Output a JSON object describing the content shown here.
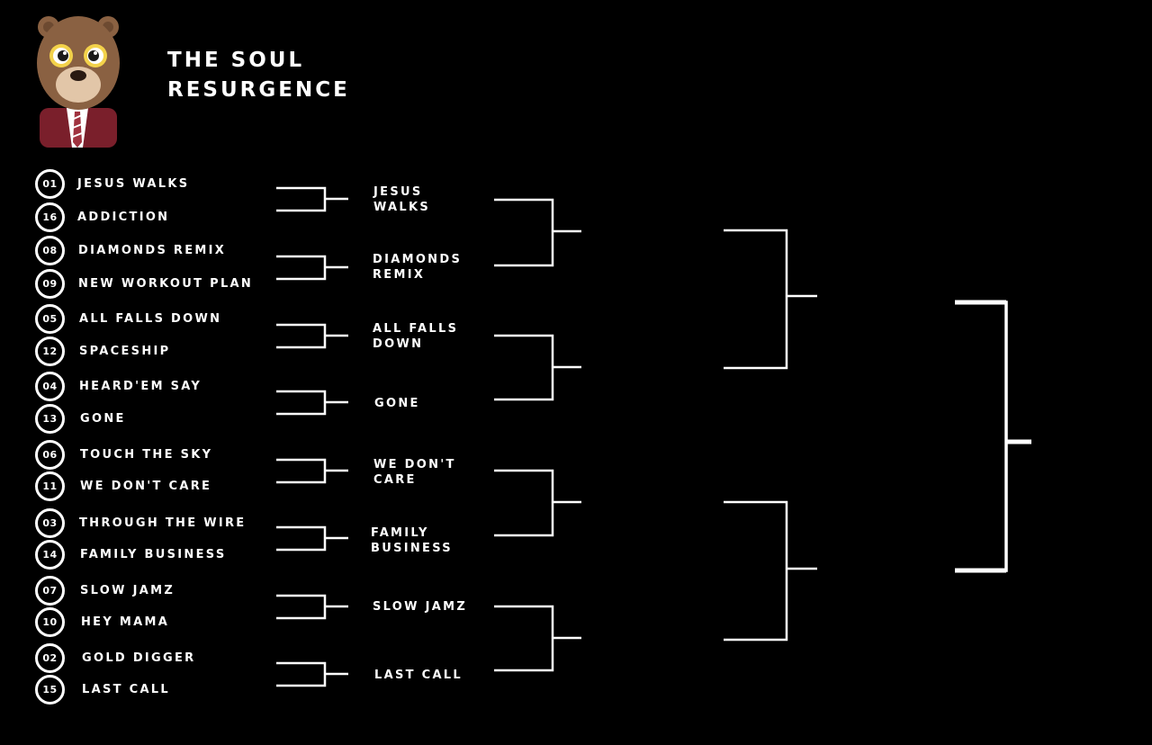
{
  "header": {
    "title_line1": "THE SOUL",
    "title_line2": "RESURGENCE",
    "logo_icon": "dropout-bear-icon"
  },
  "round1": [
    {
      "seed": "01",
      "song": "JESUS WALKS"
    },
    {
      "seed": "16",
      "song": "ADDICTION"
    },
    {
      "seed": "08",
      "song": "DIAMONDS REMIX"
    },
    {
      "seed": "09",
      "song": "NEW WORKOUT PLAN"
    },
    {
      "seed": "05",
      "song": "ALL FALLS DOWN"
    },
    {
      "seed": "12",
      "song": "SPACESHIP"
    },
    {
      "seed": "04",
      "song": "HEARD'EM SAY"
    },
    {
      "seed": "13",
      "song": "GONE"
    },
    {
      "seed": "06",
      "song": "TOUCH THE SKY"
    },
    {
      "seed": "11",
      "song": "WE DON'T CARE"
    },
    {
      "seed": "03",
      "song": "THROUGH THE WIRE"
    },
    {
      "seed": "14",
      "song": "FAMILY BUSINESS"
    },
    {
      "seed": "07",
      "song": "SLOW JAMZ"
    },
    {
      "seed": "10",
      "song": "HEY MAMA"
    },
    {
      "seed": "02",
      "song": "GOLD DIGGER"
    },
    {
      "seed": "15",
      "song": "LAST CALL"
    }
  ],
  "round2": [
    {
      "line1": "JESUS WALKS",
      "line2": ""
    },
    {
      "line1": "DIAMONDS",
      "line2": "REMIX"
    },
    {
      "line1": "ALL FALLS",
      "line2": "DOWN"
    },
    {
      "line1": "GONE",
      "line2": ""
    },
    {
      "line1": "WE DON'T",
      "line2": "CARE"
    },
    {
      "line1": "FAMILY",
      "line2": "BUSINESS"
    },
    {
      "line1": "SLOW JAMZ",
      "line2": ""
    },
    {
      "line1": "LAST CALL",
      "line2": ""
    }
  ],
  "colors": {
    "background": "#000000",
    "foreground": "#ffffff",
    "bear_fur": "#8a6142",
    "bear_jacket": "#7a1f2b"
  }
}
